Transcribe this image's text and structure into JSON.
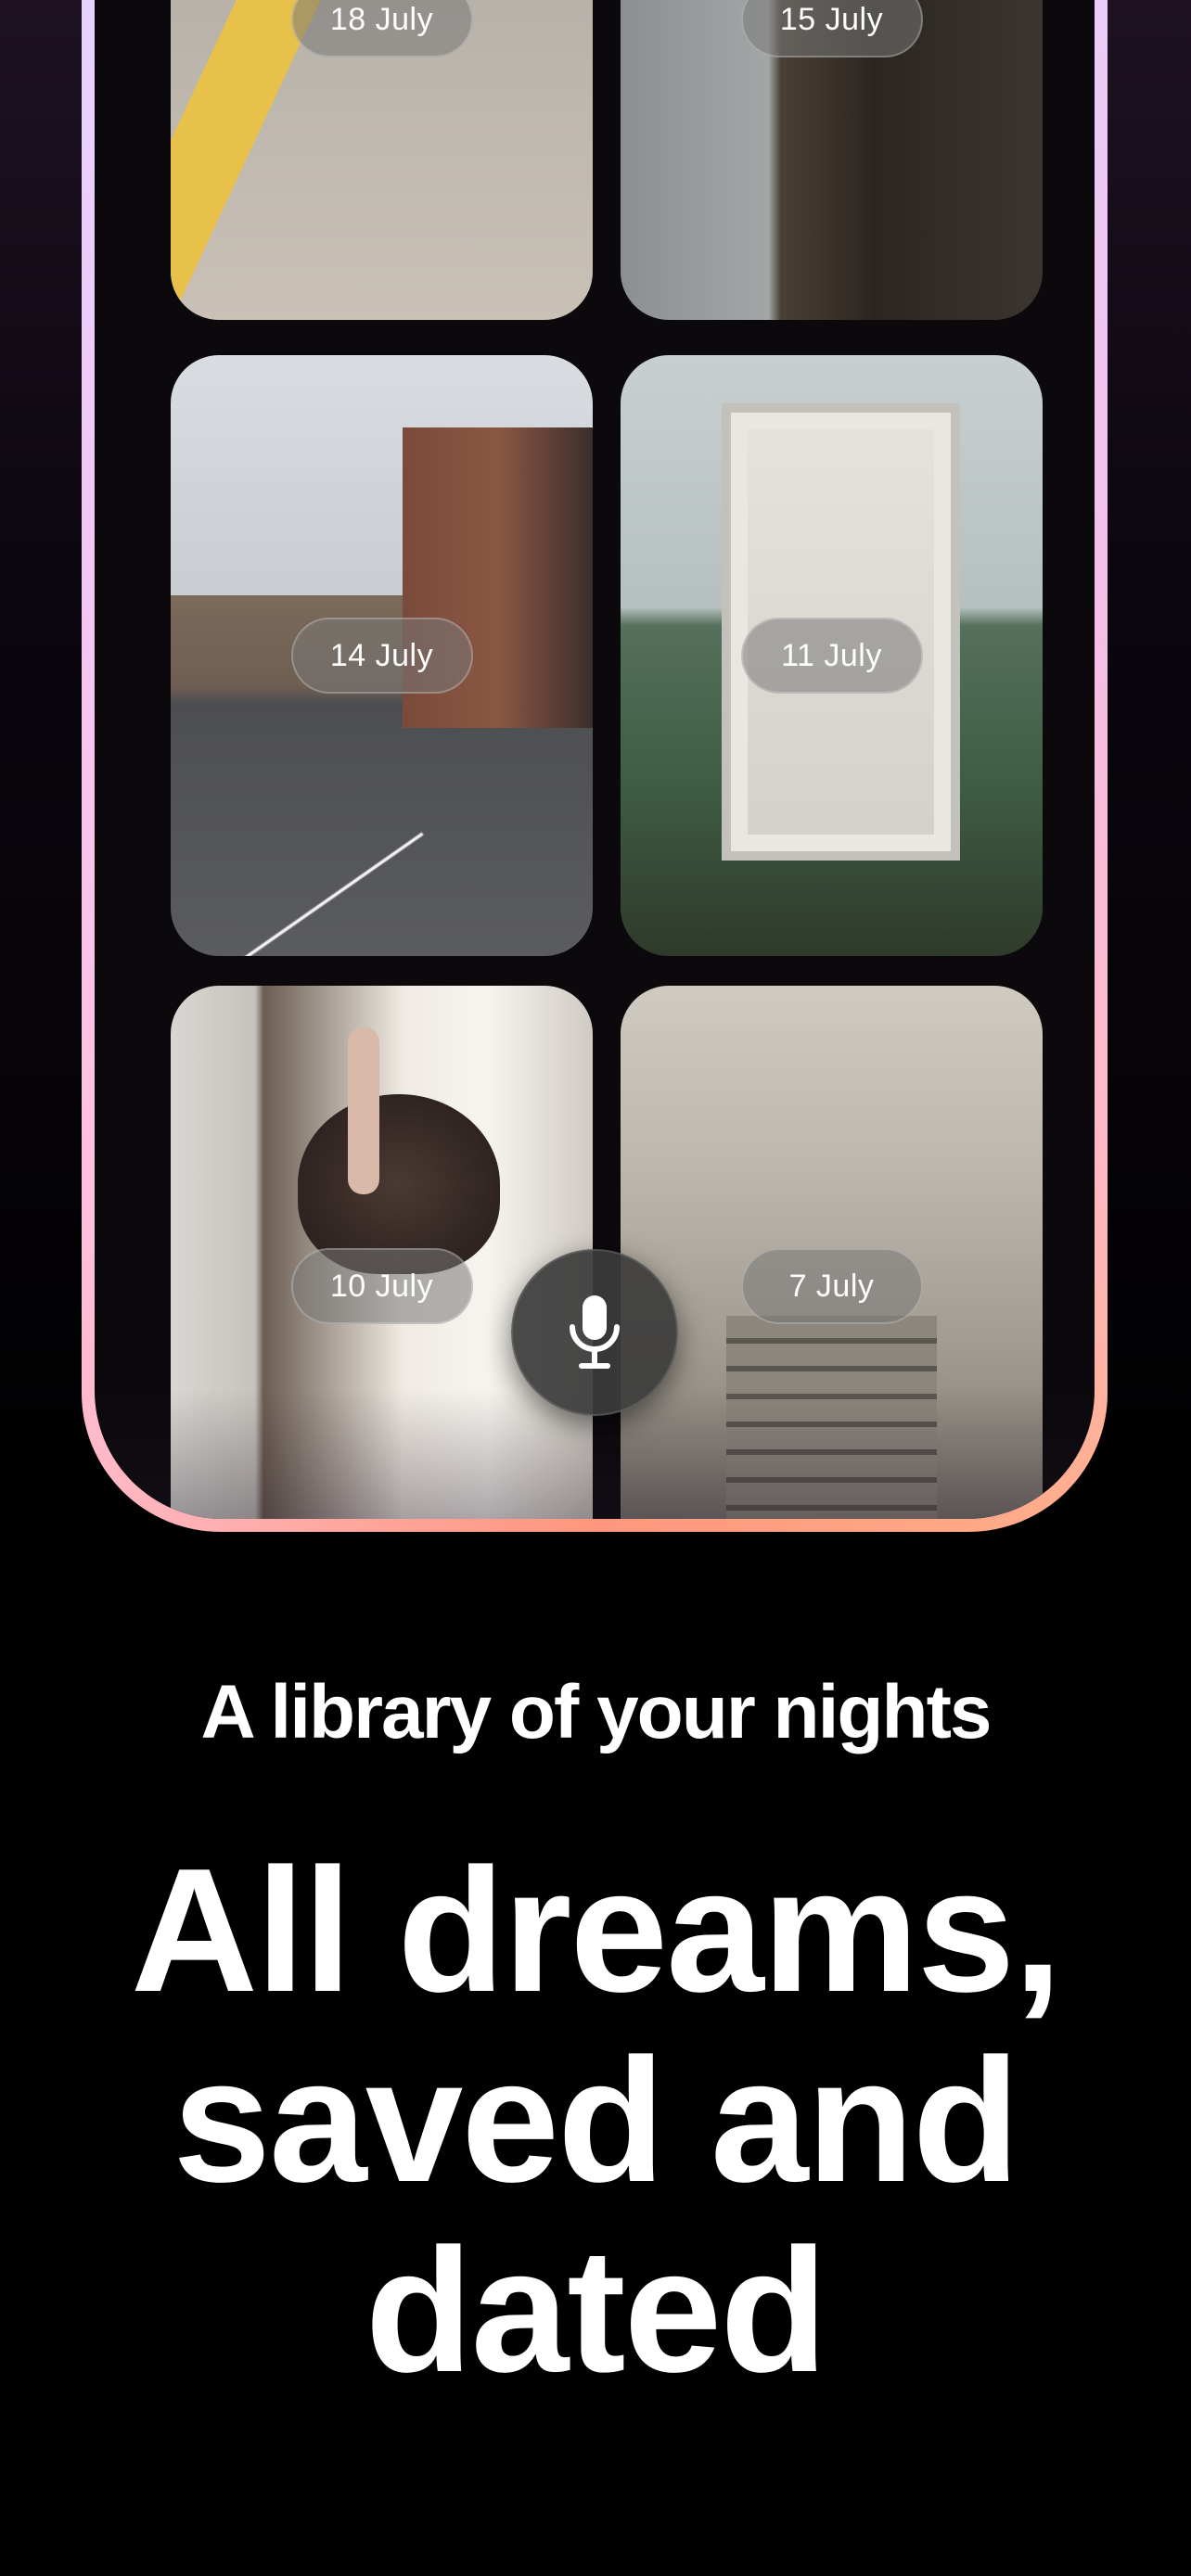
{
  "dream_cards": [
    {
      "date": "18 July",
      "scene": "train-platform"
    },
    {
      "date": "15 July",
      "scene": "flooded-room"
    },
    {
      "date": "14 July",
      "scene": "london-street"
    },
    {
      "date": "11 July",
      "scene": "door-in-field"
    },
    {
      "date": "10 July",
      "scene": "ostrich-in-hallway"
    },
    {
      "date": "7 July",
      "scene": "stairwell"
    }
  ],
  "mic": {
    "icon": "microphone-icon"
  },
  "subtitle": "A library of your nights",
  "headline": {
    "line1": "All dreams,",
    "line2": "saved and",
    "line3": "dated"
  },
  "colors": {
    "background": "#000000",
    "frame_gradient_top": "#c9c2ff",
    "frame_gradient_mid": "#ff9bb3",
    "frame_gradient_bottom": "#ff8d6a",
    "pill_background": "rgba(120,120,120,0.55)",
    "text": "#ffffff"
  }
}
